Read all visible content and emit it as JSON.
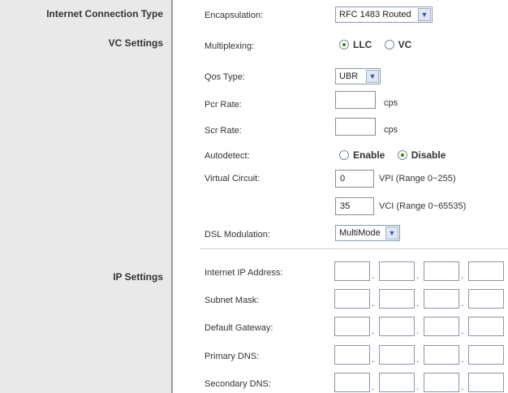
{
  "sections": {
    "internet_connection_type": "Internet Connection Type",
    "vc_settings": "VC Settings",
    "ip_settings": "IP Settings"
  },
  "encapsulation": {
    "label": "Encapsulation:",
    "value": "RFC 1483 Routed"
  },
  "multiplexing": {
    "label": "Multiplexing:",
    "options": [
      "LLC",
      "VC"
    ],
    "selected": "LLC"
  },
  "qos_type": {
    "label": "Qos Type:",
    "value": "UBR"
  },
  "pcr_rate": {
    "label": "Pcr Rate:",
    "value": "",
    "unit": "cps"
  },
  "scr_rate": {
    "label": "Scr Rate:",
    "value": "",
    "unit": "cps"
  },
  "autodetect": {
    "label": "Autodetect:",
    "options": [
      "Enable",
      "Disable"
    ],
    "selected": "Disable"
  },
  "virtual_circuit": {
    "label": "Virtual Circuit:",
    "vpi_value": "0",
    "vpi_note": "VPI (Range 0~255)",
    "vci_value": "35",
    "vci_note": "VCI (Range 0~65535)"
  },
  "dsl_modulation": {
    "label": "DSL Modulation:",
    "value": "MultiMode"
  },
  "ip_fields": [
    {
      "label": "Internet IP Address:"
    },
    {
      "label": "Subnet Mask:"
    },
    {
      "label": "Default Gateway:"
    },
    {
      "label": "Primary DNS:"
    },
    {
      "label": "Secondary DNS:"
    }
  ],
  "ip_separator": "."
}
